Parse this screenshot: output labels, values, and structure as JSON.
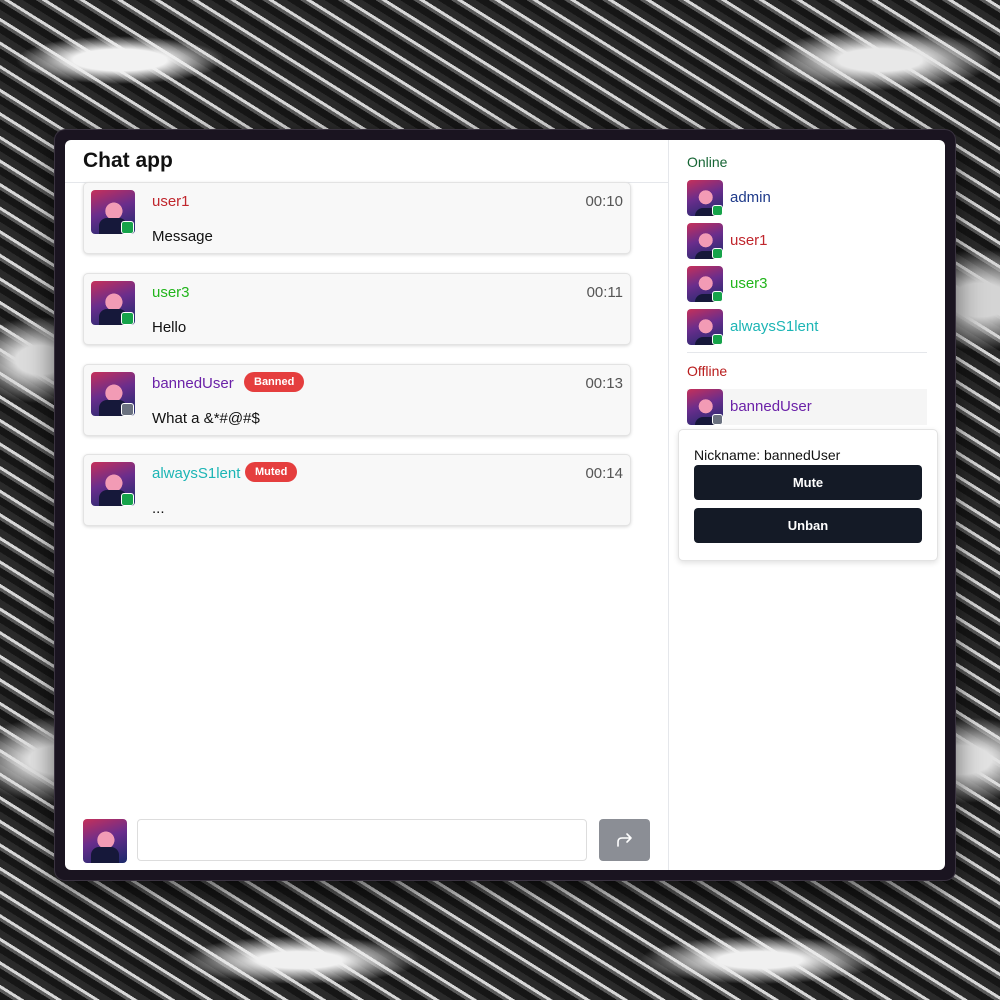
{
  "app": {
    "title": "Chat app"
  },
  "messages": [
    {
      "author": "user1",
      "time": "00:10",
      "text": "Message",
      "badge": ""
    },
    {
      "author": "user3",
      "time": "00:11",
      "text": "Hello",
      "badge": ""
    },
    {
      "author": "bannedUser",
      "time": "00:13",
      "text": "What a &*#@#$",
      "badge": "Banned"
    },
    {
      "author": "alwaysS1lent",
      "time": "00:14",
      "text": "...",
      "badge": "Muted"
    }
  ],
  "composer": {
    "placeholder": "",
    "value": "",
    "send_icon": "share-arrow-icon"
  },
  "sidebar": {
    "online_label": "Online",
    "offline_label": "Offline",
    "online_users": [
      "admin",
      "user1",
      "user3",
      "alwaysS1lent"
    ],
    "offline_users": [
      "bannedUser"
    ]
  },
  "user_menu": {
    "nickname": "Nickname: bannedUser",
    "mute_label": "Mute",
    "unban_label": "Unban"
  },
  "colors": {
    "online_status": "#16a34a",
    "offline_status": "#6b7280",
    "badge": "#e53e3e",
    "button_dark": "#141a26",
    "send_button": "#8b8e95"
  }
}
